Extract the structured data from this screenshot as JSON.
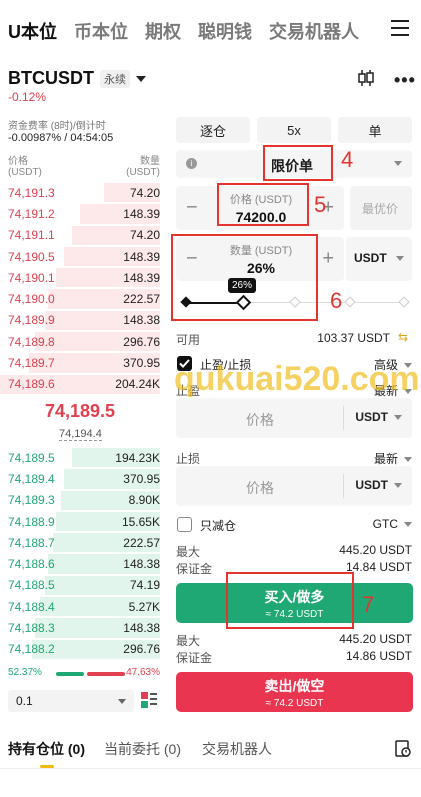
{
  "top_tabs": [
    "U本位",
    "币本位",
    "期权",
    "聪明钱",
    "交易机器人"
  ],
  "symbol": {
    "name": "BTCUSDT",
    "badge": "永续",
    "change": "-0.12%"
  },
  "funding": {
    "label": "资金费率 (8时)/倒计时",
    "value": "-0.00987% / 04:54:05"
  },
  "orderbook": {
    "price_header": "价格",
    "price_unit": "(USDT)",
    "qty_header": "数量",
    "qty_unit": "(USDT)",
    "asks": [
      {
        "price": "74,191.3",
        "qty": "74.20",
        "depth": 0.35
      },
      {
        "price": "74,191.2",
        "qty": "148.39",
        "depth": 0.5
      },
      {
        "price": "74,191.1",
        "qty": "74.20",
        "depth": 0.55
      },
      {
        "price": "74,190.5",
        "qty": "148.39",
        "depth": 0.6
      },
      {
        "price": "74,190.1",
        "qty": "148.39",
        "depth": 0.65
      },
      {
        "price": "74,190.0",
        "qty": "222.57",
        "depth": 0.7
      },
      {
        "price": "74,189.9",
        "qty": "148.38",
        "depth": 0.72
      },
      {
        "price": "74,189.8",
        "qty": "296.76",
        "depth": 0.78
      },
      {
        "price": "74,189.7",
        "qty": "370.95",
        "depth": 0.82
      },
      {
        "price": "74,189.6",
        "qty": "204.24K",
        "depth": 1.0
      }
    ],
    "last_price": "74,189.5",
    "mark_price": "74,194.4",
    "bids": [
      {
        "price": "74,189.5",
        "qty": "194.23K",
        "depth": 0.55
      },
      {
        "price": "74,189.4",
        "qty": "370.95",
        "depth": 0.6
      },
      {
        "price": "74,189.3",
        "qty": "8.90K",
        "depth": 0.62
      },
      {
        "price": "74,188.9",
        "qty": "15.65K",
        "depth": 0.65
      },
      {
        "price": "74,188.7",
        "qty": "222.57",
        "depth": 0.67
      },
      {
        "price": "74,188.6",
        "qty": "148.38",
        "depth": 0.7
      },
      {
        "price": "74,188.5",
        "qty": "74.19",
        "depth": 0.72
      },
      {
        "price": "74,188.4",
        "qty": "5.27K",
        "depth": 0.75
      },
      {
        "price": "74,188.3",
        "qty": "148.38",
        "depth": 0.78
      },
      {
        "price": "74,188.2",
        "qty": "296.76",
        "depth": 0.8
      }
    ],
    "buy_ratio": "52.37%",
    "sell_ratio": "47.63%",
    "depth_value": "0.1"
  },
  "order_form": {
    "margin_mode": "逐仓",
    "leverage": "5x",
    "position_mode": "单",
    "order_type": "限价单",
    "price_label": "价格 (USDT)",
    "price_value": "74200.0",
    "best_price": "最优价",
    "qty_label": "数量 (USDT)",
    "qty_value": "26%",
    "qty_unit": "USDT",
    "slider_tooltip": "26%",
    "slider_value": 0.26,
    "available_label": "可用",
    "available_value": "103.37 USDT",
    "tpsl_label": "止盈/止损",
    "advanced_label": "高级",
    "tp_label": "止盈",
    "tp_trigger": "最新",
    "tp_placeholder": "价格",
    "tp_unit": "USDT",
    "sl_label": "止损",
    "sl_trigger": "最新",
    "sl_placeholder": "价格",
    "sl_unit": "USDT",
    "reduce_only_label": "只减仓",
    "tif": "GTC",
    "buy_max_label": "最大",
    "buy_max_value": "445.20 USDT",
    "buy_margin_label": "保证金",
    "buy_margin_value": "14.84 USDT",
    "buy_label": "买入/做多",
    "buy_sub": "≈ 74.2 USDT",
    "sell_max_label": "最大",
    "sell_max_value": "445.20 USDT",
    "sell_margin_label": "保证金",
    "sell_margin_value": "14.86 USDT",
    "sell_label": "卖出/做空",
    "sell_sub": "≈ 74.2 USDT"
  },
  "annotations": [
    "4",
    "5",
    "6",
    "7"
  ],
  "watermark": "qukuai520.com",
  "bottom_tabs": {
    "positions": "持有仓位 (0)",
    "open_orders": "当前委托 (0)",
    "bots": "交易机器人"
  },
  "colors": {
    "buy": "#1fa874",
    "sell": "#ea3550",
    "annotation": "#e3342f",
    "accent": "#f0b90b"
  }
}
